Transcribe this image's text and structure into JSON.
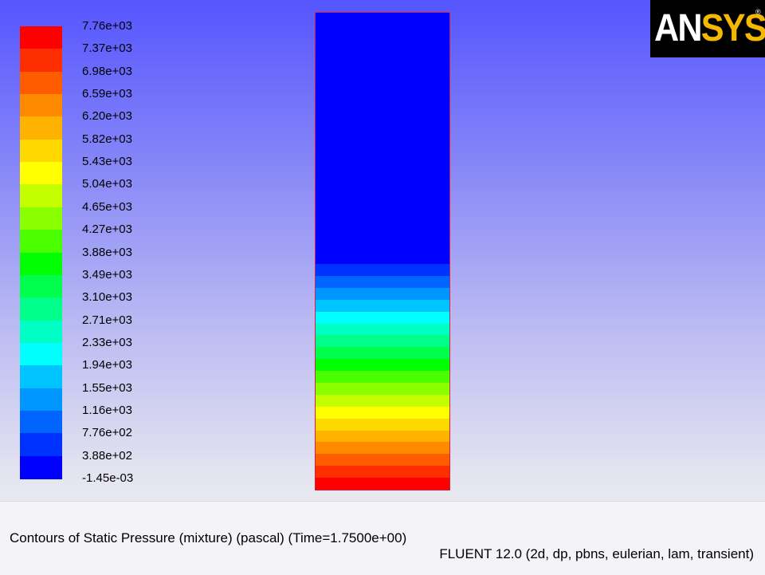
{
  "logo": {
    "part1": "AN",
    "part2": "SYS",
    "registered": "®"
  },
  "legend": {
    "labels": [
      "7.76e+03",
      "7.37e+03",
      "6.98e+03",
      "6.59e+03",
      "6.20e+03",
      "5.82e+03",
      "5.43e+03",
      "5.04e+03",
      "4.65e+03",
      "4.27e+03",
      "3.88e+03",
      "3.49e+03",
      "3.10e+03",
      "2.71e+03",
      "2.33e+03",
      "1.94e+03",
      "1.55e+03",
      "1.16e+03",
      "7.76e+02",
      "3.88e+02",
      "-1.45e-03"
    ],
    "colors_top_to_bottom": [
      "#ff0000",
      "#ff2e00",
      "#ff5c00",
      "#ff8a00",
      "#ffb200",
      "#ffd800",
      "#ffff00",
      "#c4ff00",
      "#8aff00",
      "#4cff00",
      "#00ff00",
      "#00ff4c",
      "#00ff8a",
      "#00ffc4",
      "#00ffff",
      "#00c4ff",
      "#0096ff",
      "#0064ff",
      "#0032ff",
      "#0000ff"
    ]
  },
  "contour": {
    "uniform_region_color": "#0000ff",
    "uniform_region_fraction": 0.527,
    "bands_top_to_bottom": [
      "#0032ff",
      "#0064ff",
      "#0096ff",
      "#00c4ff",
      "#00ffff",
      "#00ffc4",
      "#00ff8a",
      "#00ff4c",
      "#00ff00",
      "#4cff00",
      "#8aff00",
      "#c4ff00",
      "#ffff00",
      "#ffd800",
      "#ffb200",
      "#ff8a00",
      "#ff5c00",
      "#ff2e00",
      "#ff0000"
    ],
    "border_color": "#cc2244"
  },
  "caption": "Contours of Static Pressure (mixture)  (pascal)  (Time=1.7500e+00)",
  "solver_info": "FLUENT 12.0 (2d, dp, pbns, eulerian, lam, transient)"
}
